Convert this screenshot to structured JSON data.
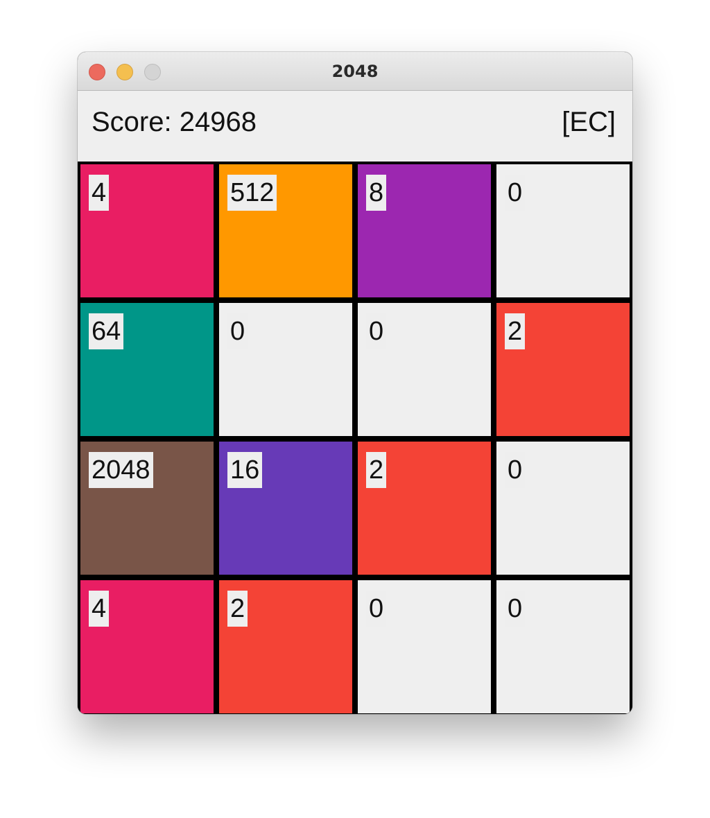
{
  "window": {
    "title": "2048"
  },
  "header": {
    "score_text": "Score: 24968",
    "mode_text": "[EC]"
  },
  "board": {
    "rows": [
      [
        {
          "value": "4",
          "color": "#e91e63"
        },
        {
          "value": "512",
          "color": "#ff9800"
        },
        {
          "value": "8",
          "color": "#9c27b0"
        },
        {
          "value": "0",
          "color": "#efefef"
        }
      ],
      [
        {
          "value": "64",
          "color": "#009688"
        },
        {
          "value": "0",
          "color": "#efefef"
        },
        {
          "value": "0",
          "color": "#efefef"
        },
        {
          "value": "2",
          "color": "#f44336"
        }
      ],
      [
        {
          "value": "2048",
          "color": "#795548"
        },
        {
          "value": "16",
          "color": "#673ab7"
        },
        {
          "value": "2",
          "color": "#f44336"
        },
        {
          "value": "0",
          "color": "#efefef"
        }
      ],
      [
        {
          "value": "4",
          "color": "#e91e63"
        },
        {
          "value": "2",
          "color": "#f44336"
        },
        {
          "value": "0",
          "color": "#efefef"
        },
        {
          "value": "0",
          "color": "#efefef"
        }
      ]
    ]
  }
}
